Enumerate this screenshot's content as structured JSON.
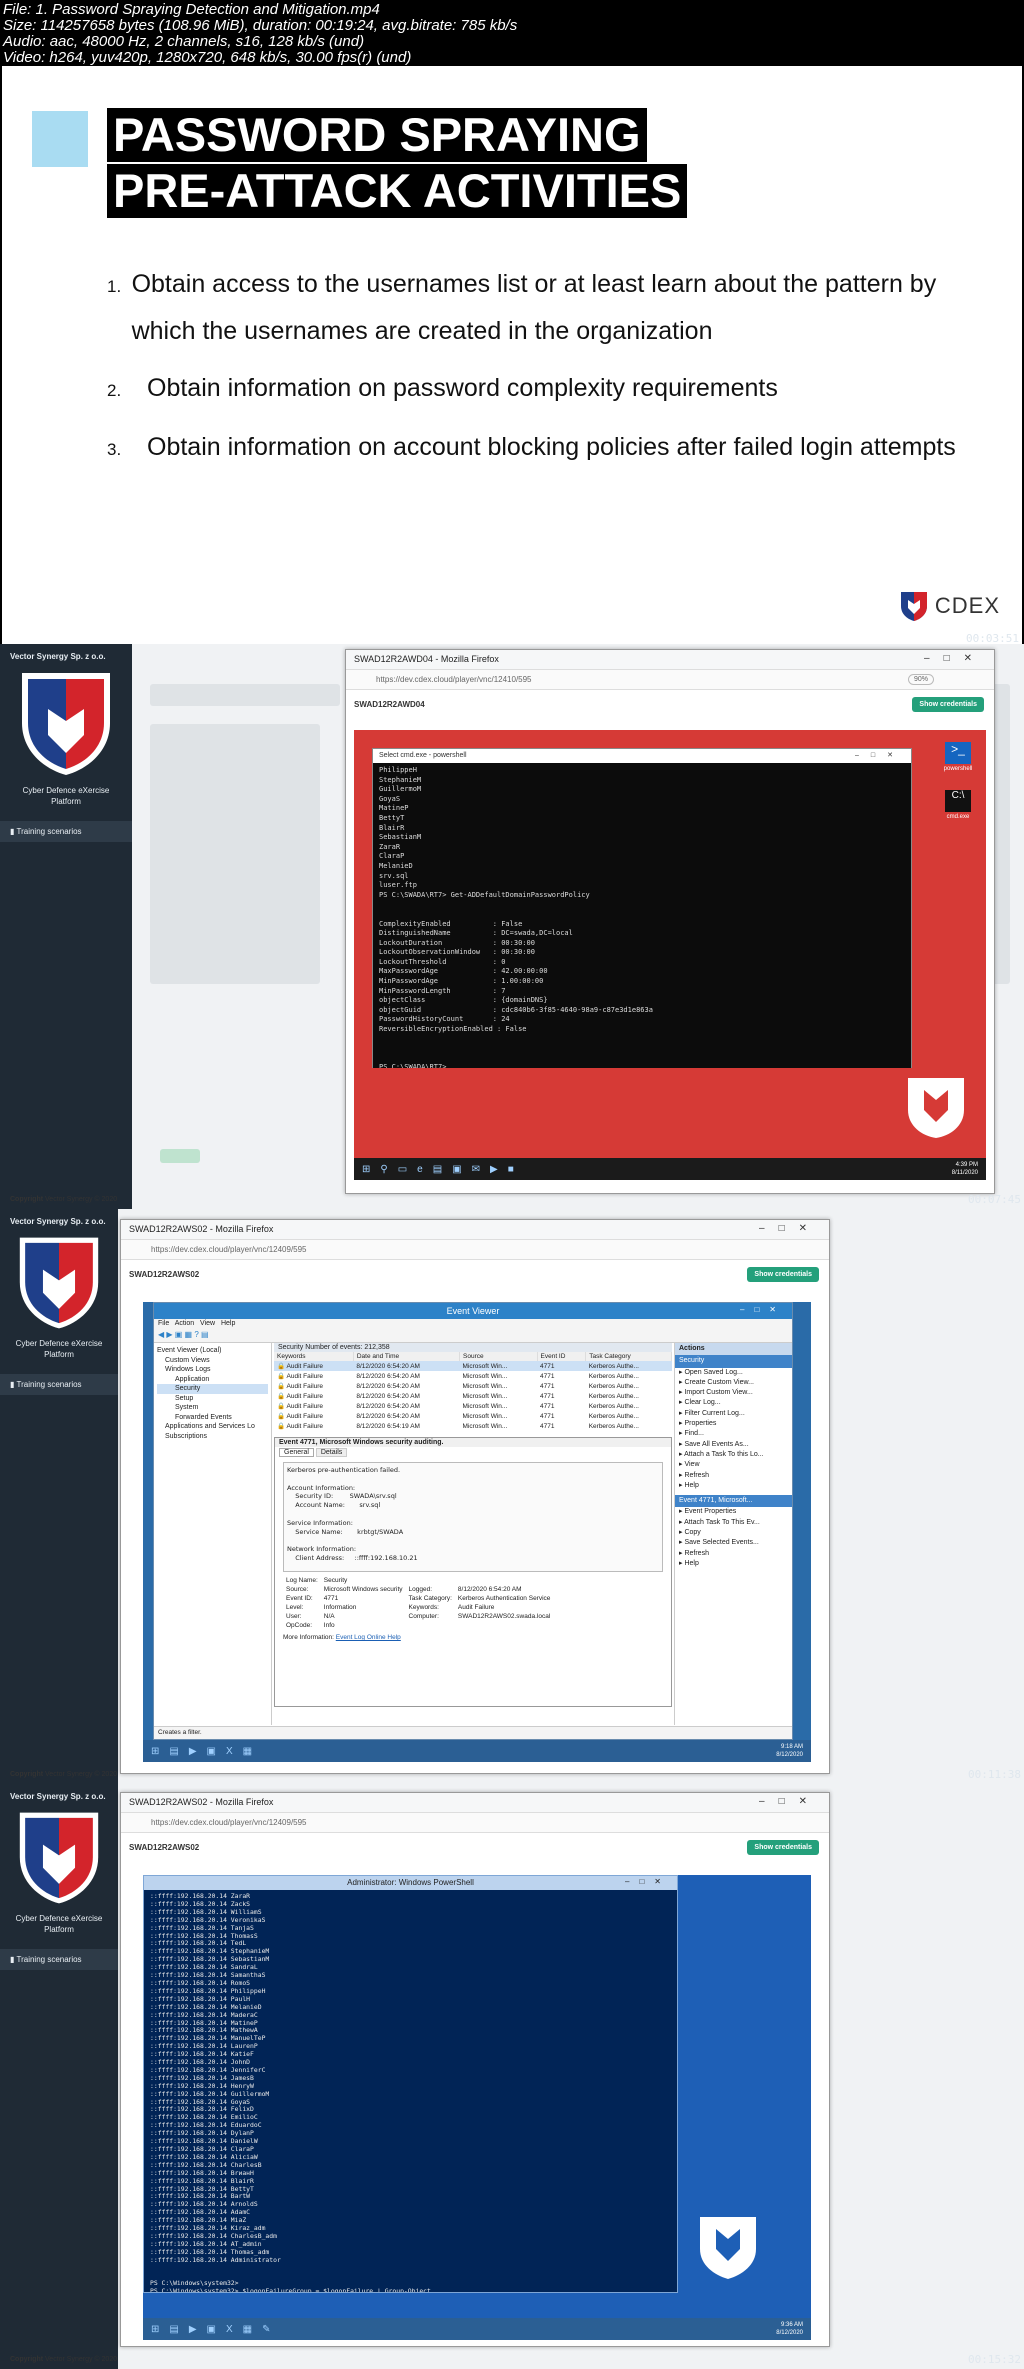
{
  "file_info": {
    "line1": "File: 1. Password Spraying Detection and Mitigation.mp4",
    "line2": "Size: 114257658 bytes (108.96 MiB), duration: 00:19:24, avg.bitrate: 785 kb/s",
    "line3": "Audio: aac, 48000 Hz, 2 channels, s16, 128 kb/s (und)",
    "line4": "Video: h264, yuv420p, 1280x720, 648 kb/s, 30.00 fps(r) (und)"
  },
  "timestamps": [
    "00:03:51",
    "00:07:45",
    "00:11:38",
    "00:15:32"
  ],
  "slide": {
    "title_line1": "PASSWORD SPRAYING",
    "title_line2": "PRE-ATTACK ACTIVITIES",
    "items": [
      {
        "num": "1.",
        "text": "Obtain access to the usernames list or at least learn about the pattern by which the usernames are created in the organization"
      },
      {
        "num": "2.",
        "text": "Obtain information on password complexity requirements"
      },
      {
        "num": "3.",
        "text": "Obtain information on account blocking policies after failed login attempts"
      }
    ],
    "logo_text": "CDEX"
  },
  "platform": {
    "org": "Vector Synergy Sp. z o.o.",
    "platform_name_1": "Cyber Defence eXercise",
    "platform_name_2": "Platform",
    "nav_training": "Training scenarios",
    "copyright_label": "Copyright",
    "copyright_text": "Vector Synergy © 2020",
    "show_credentials": "Show credentials"
  },
  "frame1": {
    "window_title": "SWAD12R2AWD04 - Mozilla Firefox",
    "url": "https://dev.cdex.cloud/player/vnc/12410/595",
    "zoom": "90%",
    "vm_name": "SWAD12R2AWD04",
    "terminal_title": "Select cmd.exe - powershell",
    "terminal_lines": [
      "PhilippeH",
      "StephanieM",
      "GuillermoM",
      "GoyaS",
      "MatineP",
      "BettyT",
      "BlairR",
      "SebastianM",
      "ZaraR",
      "ClaraP",
      "MelanieD",
      "srv.sql",
      "luser.ftp",
      "PS C:\\SWADA\\RT7> Get-ADDefaultDomainPasswordPolicy",
      "",
      "",
      "ComplexityEnabled          : False",
      "DistinguishedName          : DC=swada,DC=local",
      "LockoutDuration            : 00:30:00",
      "LockoutObservationWindow   : 00:30:00",
      "LockoutThreshold           : 0",
      "MaxPasswordAge             : 42.00:00:00",
      "MinPasswordAge             : 1.00:00:00",
      "MinPasswordLength          : 7",
      "objectClass                : {domainDNS}",
      "objectGuid                 : cdc840b6-3f85-4640-98a9-c87e3d1e863a",
      "PasswordHistoryCount       : 24",
      "ReversibleEncryptionEnabled : False",
      "",
      "",
      "",
      "PS C:\\SWADA\\RT7> _"
    ],
    "desktop_icons": [
      "powershell",
      "cmd.exe"
    ],
    "tray_time": "4:39 PM",
    "tray_date": "8/11/2020"
  },
  "frame2": {
    "window_title": "SWAD12R2AWS02 - Mozilla Firefox",
    "url": "https://dev.cdex.cloud/player/vnc/12409/595",
    "vm_name": "SWAD12R2AWS02",
    "ev_title": "Event Viewer",
    "menu": [
      "File",
      "Action",
      "View",
      "Help"
    ],
    "tree": [
      "Event Viewer (Local)",
      "Custom Views",
      "Windows Logs",
      "Application",
      "Security",
      "Setup",
      "System",
      "Forwarded Events",
      "Applications and Services Lo",
      "Subscriptions"
    ],
    "log_header": "Security   Number of events: 212,358",
    "columns": [
      "Keywords",
      "Date and Time",
      "Source",
      "Event ID",
      "Task Category"
    ],
    "rows": [
      [
        "Audit Failure",
        "8/12/2020 6:54:20 AM",
        "Microsoft Win...",
        "4771",
        "Kerberos Authe..."
      ],
      [
        "Audit Failure",
        "8/12/2020 6:54:20 AM",
        "Microsoft Win...",
        "4771",
        "Kerberos Authe..."
      ],
      [
        "Audit Failure",
        "8/12/2020 6:54:20 AM",
        "Microsoft Win...",
        "4771",
        "Kerberos Authe..."
      ],
      [
        "Audit Failure",
        "8/12/2020 6:54:20 AM",
        "Microsoft Win...",
        "4771",
        "Kerberos Authe..."
      ],
      [
        "Audit Failure",
        "8/12/2020 6:54:20 AM",
        "Microsoft Win...",
        "4771",
        "Kerberos Authe..."
      ],
      [
        "Audit Failure",
        "8/12/2020 6:54:20 AM",
        "Microsoft Win...",
        "4771",
        "Kerberos Authe..."
      ],
      [
        "Audit Failure",
        "8/12/2020 6:54:19 AM",
        "Microsoft Win...",
        "4771",
        "Kerberos Authe..."
      ]
    ],
    "event_header": "Event 4771, Microsoft Windows security auditing.",
    "tabs": [
      "General",
      "Details"
    ],
    "event_text": [
      "Kerberos pre-authentication failed.",
      "",
      "Account Information:",
      "    Security ID:        SWADA\\srv.sql",
      "    Account Name:       srv.sql",
      "",
      "Service Information:",
      "    Service Name:       krbtgt/SWADA",
      "",
      "Network Information:",
      "    Client Address:     ::ffff:192.168.10.21"
    ],
    "props": [
      [
        "Log Name:",
        "Security",
        "",
        ""
      ],
      [
        "Source:",
        "Microsoft Windows security",
        "Logged:",
        "8/12/2020 6:54:20 AM"
      ],
      [
        "Event ID:",
        "4771",
        "Task Category:",
        "Kerberos Authentication Service"
      ],
      [
        "Level:",
        "Information",
        "Keywords:",
        "Audit Failure"
      ],
      [
        "User:",
        "N/A",
        "Computer:",
        "SWAD12R2AWS02.swada.local"
      ],
      [
        "OpCode:",
        "Info",
        "",
        ""
      ]
    ],
    "more_info_label": "More Information:",
    "more_info_link": "Event Log Online Help",
    "actions_title": "Actions",
    "actions_section1": "Security",
    "actions1": [
      "Open Saved Log...",
      "Create Custom View...",
      "Import Custom View...",
      "Clear Log...",
      "Filter Current Log...",
      "Properties",
      "Find...",
      "Save All Events As...",
      "Attach a Task To this Lo...",
      "View",
      "Refresh",
      "Help"
    ],
    "actions_section2": "Event 4771, Microsoft...",
    "actions2": [
      "Event Properties",
      "Attach Task To This Ev...",
      "Copy",
      "Save Selected Events...",
      "Refresh",
      "Help"
    ],
    "status": "Creates a filter.",
    "tray_time": "9:18 AM",
    "tray_date": "8/12/2020"
  },
  "frame3": {
    "window_title": "SWAD12R2AWS02 - Mozilla Firefox",
    "url": "https://dev.cdex.cloud/player/vnc/12409/595",
    "vm_name": "SWAD12R2AWS02",
    "ps_title": "Administrator: Windows PowerShell",
    "ps_lines": [
      "::ffff:192.168.20.14 ZaraR",
      "::ffff:192.168.20.14 ZackS",
      "::ffff:192.168.20.14 WilliamS",
      "::ffff:192.168.20.14 VeronikaS",
      "::ffff:192.168.20.14 TanjaS",
      "::ffff:192.168.20.14 ThomasS",
      "::ffff:192.168.20.14 TedL",
      "::ffff:192.168.20.14 StephanieM",
      "::ffff:192.168.20.14 SebastianM",
      "::ffff:192.168.20.14 SandraL",
      "::ffff:192.168.20.14 SamanthaS",
      "::ffff:192.168.20.14 RomoS",
      "::ffff:192.168.20.14 PhilippeH",
      "::ffff:192.168.20.14 PaulH",
      "::ffff:192.168.20.14 MelanieD",
      "::ffff:192.168.20.14 MaderaC",
      "::ffff:192.168.20.14 MatineP",
      "::ffff:192.168.20.14 MathewA",
      "::ffff:192.168.20.14 ManuelTeP",
      "::ffff:192.168.20.14 LaurenP",
      "::ffff:192.168.20.14 KatieF",
      "::ffff:192.168.20.14 JohnD",
      "::ffff:192.168.20.14 JenniferC",
      "::ffff:192.168.20.14 JamesB",
      "::ffff:192.168.20.14 HenryW",
      "::ffff:192.168.20.14 GuillermoM",
      "::ffff:192.168.20.14 GoyaS",
      "::ffff:192.168.20.14 FelixD",
      "::ffff:192.168.20.14 EmilioC",
      "::ffff:192.168.20.14 EduardoC",
      "::ffff:192.168.20.14 DylanP",
      "::ffff:192.168.20.14 DanielW",
      "::ffff:192.168.20.14 ClaraP",
      "::ffff:192.168.20.14 AliciaW",
      "::ffff:192.168.20.14 CharlesB",
      "::ffff:192.168.20.14 BrианH",
      "::ffff:192.168.20.14 BlairR",
      "::ffff:192.168.20.14 BettyT",
      "::ffff:192.168.20.14 BartW",
      "::ffff:192.168.20.14 ArnoldS",
      "::ffff:192.168.20.14 AdamC",
      "::ffff:192.168.20.14 MiaZ",
      "::ffff:192.168.20.14 Kiraz_adm",
      "::ffff:192.168.20.14 CharlesB_adm",
      "::ffff:192.168.20.14 AT_admin",
      "::ffff:192.168.20.14 Thomas_adm",
      "::ffff:192.168.20.14 Administrator",
      "",
      "",
      "PS C:\\Windows\\system32>",
      "PS C:\\Windows\\system32> $logonFailureGroup = $logonFailure | Group-Object _"
    ],
    "tray_time": "9:36 AM",
    "tray_date": "8/12/2020"
  }
}
